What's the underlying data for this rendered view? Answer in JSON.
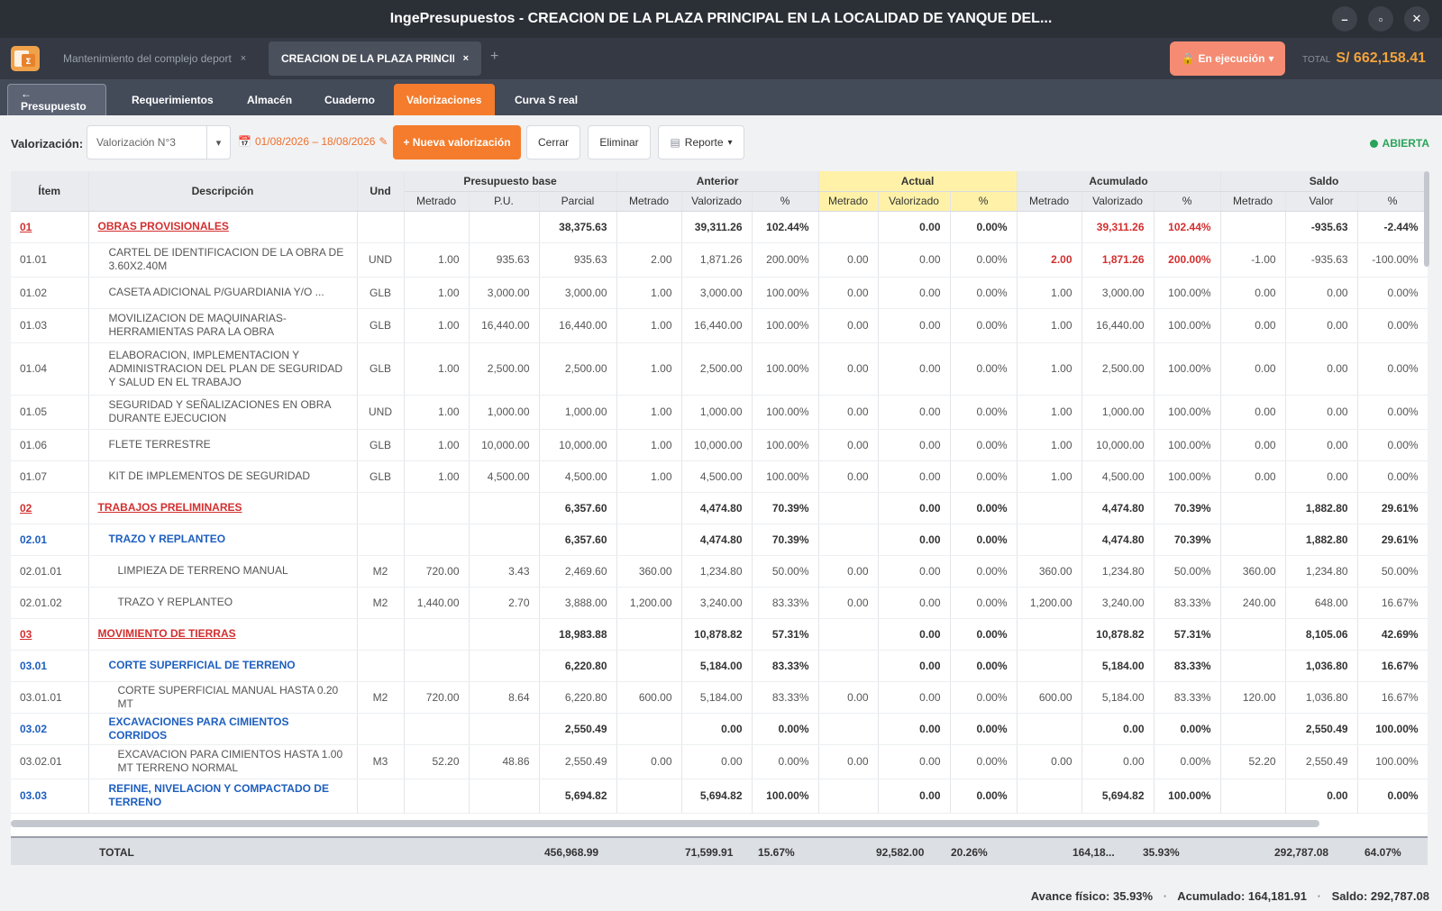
{
  "window": {
    "title": "IngePresupuestos  -  CREACION DE LA PLAZA PRINCIPAL EN LA LOCALIDAD DE YANQUE DEL...",
    "controls": [
      "–",
      "▫",
      "✕"
    ]
  },
  "tabs": {
    "logo_icon": "spreadsheet-logo-icon",
    "items": [
      {
        "label": "Mantenimiento del complejo deport"
      },
      {
        "label": "CREACION DE LA PLAZA PRINCIPA"
      }
    ],
    "close": "×",
    "add": "+"
  },
  "header": {
    "status_button": "En ejecución",
    "status_caret": "▾",
    "total_label": "TOTAL",
    "total_value": "S/ 662,158.41"
  },
  "modules": {
    "back": "← Presupuesto",
    "items": [
      "Requerimientos",
      "Almacén",
      "Cuaderno",
      "Valorizaciones",
      "Curva S real"
    ],
    "active": "Valorizaciones"
  },
  "toolbar": {
    "label": "Valorización:",
    "select_value": "Valorización N°3",
    "date_range": "01/08/2026 – 18/08/2026",
    "new_button": "+ Nueva valorización",
    "close_button": "Cerrar",
    "delete_button": "Eliminar",
    "report_button": "Reporte",
    "status": "ABIERTA",
    "colors": {
      "accent": "#f47c2c",
      "open": "#2aa35a",
      "exec": "#f58b72"
    }
  },
  "table": {
    "col_item": "Ítem",
    "col_desc": "Descripción",
    "col_und": "Und",
    "groups": [
      "Presupuesto base",
      "Anterior",
      "Actual",
      "Acumulado",
      "Saldo"
    ],
    "sub_base": [
      "Metrado",
      "P.U.",
      "Parcial"
    ],
    "sub_anterior": [
      "Metrado",
      "Valorizado",
      "%"
    ],
    "sub_actual": [
      "Metrado",
      "Valorizado",
      "%"
    ],
    "sub_acumulado": [
      "Metrado",
      "Valorizado",
      "%"
    ],
    "sub_saldo": [
      "Metrado",
      "Valor",
      "%"
    ],
    "rows": [
      {
        "kind": "lvl1",
        "cells": [
          "01",
          "OBRAS PROVISIONALES",
          "",
          "",
          "",
          "38,375.63",
          "",
          "39,311.26",
          "102.44%",
          "",
          "0.00",
          "0.00%",
          "",
          "39,311.26",
          "102.44%",
          "",
          "-935.63",
          "-2.44%"
        ],
        "red": [
          13,
          14
        ]
      },
      {
        "kind": "leaf",
        "h": "tall",
        "cells": [
          "01.01",
          "CARTEL DE IDENTIFICACION DE LA OBRA DE 3.60X2.40M",
          "UND",
          "1.00",
          "935.63",
          "935.63",
          "2.00",
          "1,871.26",
          "200.00%",
          "0.00",
          "0.00",
          "0.00%",
          "2.00",
          "1,871.26",
          "200.00%",
          "-1.00",
          "-935.63",
          "-100.00%"
        ],
        "red": [
          12,
          13,
          14
        ]
      },
      {
        "kind": "leaf",
        "cells": [
          "01.02",
          "CASETA ADICIONAL P/GUARDIANIA Y/O ...",
          "GLB",
          "1.00",
          "3,000.00",
          "3,000.00",
          "1.00",
          "3,000.00",
          "100.00%",
          "0.00",
          "0.00",
          "0.00%",
          "1.00",
          "3,000.00",
          "100.00%",
          "0.00",
          "0.00",
          "0.00%"
        ]
      },
      {
        "kind": "leaf",
        "h": "tall",
        "cells": [
          "01.03",
          "MOVILIZACION DE MAQUINARIAS-HERRAMIENTAS PARA LA OBRA",
          "GLB",
          "1.00",
          "16,440.00",
          "16,440.00",
          "1.00",
          "16,440.00",
          "100.00%",
          "0.00",
          "0.00",
          "0.00%",
          "1.00",
          "16,440.00",
          "100.00%",
          "0.00",
          "0.00",
          "0.00%"
        ]
      },
      {
        "kind": "leaf",
        "h": "vtall",
        "cells": [
          "01.04",
          "ELABORACION, IMPLEMENTACION Y ADMINISTRACION DEL PLAN DE SEGURIDAD Y SALUD EN EL TRABAJO",
          "GLB",
          "1.00",
          "2,500.00",
          "2,500.00",
          "1.00",
          "2,500.00",
          "100.00%",
          "0.00",
          "0.00",
          "0.00%",
          "1.00",
          "2,500.00",
          "100.00%",
          "0.00",
          "0.00",
          "0.00%"
        ]
      },
      {
        "kind": "leaf",
        "h": "tall",
        "cells": [
          "01.05",
          "SEGURIDAD Y SEÑALIZACIONES EN OBRA DURANTE EJECUCION",
          "UND",
          "1.00",
          "1,000.00",
          "1,000.00",
          "1.00",
          "1,000.00",
          "100.00%",
          "0.00",
          "0.00",
          "0.00%",
          "1.00",
          "1,000.00",
          "100.00%",
          "0.00",
          "0.00",
          "0.00%"
        ]
      },
      {
        "kind": "leaf",
        "cells": [
          "01.06",
          "FLETE TERRESTRE",
          "GLB",
          "1.00",
          "10,000.00",
          "10,000.00",
          "1.00",
          "10,000.00",
          "100.00%",
          "0.00",
          "0.00",
          "0.00%",
          "1.00",
          "10,000.00",
          "100.00%",
          "0.00",
          "0.00",
          "0.00%"
        ]
      },
      {
        "kind": "leaf",
        "cells": [
          "01.07",
          "KIT DE IMPLEMENTOS DE SEGURIDAD",
          "GLB",
          "1.00",
          "4,500.00",
          "4,500.00",
          "1.00",
          "4,500.00",
          "100.00%",
          "0.00",
          "0.00",
          "0.00%",
          "1.00",
          "4,500.00",
          "100.00%",
          "0.00",
          "0.00",
          "0.00%"
        ]
      },
      {
        "kind": "lvl1",
        "cells": [
          "02",
          "TRABAJOS  PRELIMINARES",
          "",
          "",
          "",
          "6,357.60",
          "",
          "4,474.80",
          "70.39%",
          "",
          "0.00",
          "0.00%",
          "",
          "4,474.80",
          "70.39%",
          "",
          "1,882.80",
          "29.61%"
        ]
      },
      {
        "kind": "lvl2",
        "cells": [
          "02.01",
          "TRAZO Y REPLANTEO",
          "",
          "",
          "",
          "6,357.60",
          "",
          "4,474.80",
          "70.39%",
          "",
          "0.00",
          "0.00%",
          "",
          "4,474.80",
          "70.39%",
          "",
          "1,882.80",
          "29.61%"
        ]
      },
      {
        "kind": "leaf3",
        "cells": [
          "02.01.01",
          "LIMPIEZA DE TERRENO MANUAL",
          "M2",
          "720.00",
          "3.43",
          "2,469.60",
          "360.00",
          "1,234.80",
          "50.00%",
          "0.00",
          "0.00",
          "0.00%",
          "360.00",
          "1,234.80",
          "50.00%",
          "360.00",
          "1,234.80",
          "50.00%"
        ]
      },
      {
        "kind": "leaf3",
        "cells": [
          "02.01.02",
          "TRAZO Y REPLANTEO",
          "M2",
          "1,440.00",
          "2.70",
          "3,888.00",
          "1,200.00",
          "3,240.00",
          "83.33%",
          "0.00",
          "0.00",
          "0.00%",
          "1,200.00",
          "3,240.00",
          "83.33%",
          "240.00",
          "648.00",
          "16.67%"
        ]
      },
      {
        "kind": "lvl1",
        "cells": [
          "03",
          "MOVIMIENTO DE TIERRAS",
          "",
          "",
          "",
          "18,983.88",
          "",
          "10,878.82",
          "57.31%",
          "",
          "0.00",
          "0.00%",
          "",
          "10,878.82",
          "57.31%",
          "",
          "8,105.06",
          "42.69%"
        ]
      },
      {
        "kind": "lvl2",
        "cells": [
          "03.01",
          "CORTE SUPERFICIAL DE TERRENO",
          "",
          "",
          "",
          "6,220.80",
          "",
          "5,184.00",
          "83.33%",
          "",
          "0.00",
          "0.00%",
          "",
          "5,184.00",
          "83.33%",
          "",
          "1,036.80",
          "16.67%"
        ]
      },
      {
        "kind": "leaf3",
        "cells": [
          "03.01.01",
          "CORTE SUPERFICIAL MANUAL HASTA 0.20 MT",
          "M2",
          "720.00",
          "8.64",
          "6,220.80",
          "600.00",
          "5,184.00",
          "83.33%",
          "0.00",
          "0.00",
          "0.00%",
          "600.00",
          "5,184.00",
          "83.33%",
          "120.00",
          "1,036.80",
          "16.67%"
        ]
      },
      {
        "kind": "lvl2",
        "cells": [
          "03.02",
          "EXCAVACIONES PARA CIMIENTOS CORRIDOS",
          "",
          "",
          "",
          "2,550.49",
          "",
          "0.00",
          "0.00%",
          "",
          "0.00",
          "0.00%",
          "",
          "0.00",
          "0.00%",
          "",
          "2,550.49",
          "100.00%"
        ]
      },
      {
        "kind": "leaf3",
        "h": "tall",
        "cells": [
          "03.02.01",
          "EXCAVACION PARA CIMIENTOS HASTA 1.00 MT TERRENO NORMAL",
          "M3",
          "52.20",
          "48.86",
          "2,550.49",
          "0.00",
          "0.00",
          "0.00%",
          "0.00",
          "0.00",
          "0.00%",
          "0.00",
          "0.00",
          "0.00%",
          "52.20",
          "2,550.49",
          "100.00%"
        ]
      },
      {
        "kind": "lvl2",
        "h": "tall",
        "cells": [
          "03.03",
          "REFINE, NIVELACION Y COMPACTADO DE TERRENO",
          "",
          "",
          "",
          "5,694.82",
          "",
          "5,694.82",
          "100.00%",
          "",
          "0.00",
          "0.00%",
          "",
          "5,694.82",
          "100.00%",
          "",
          "0.00",
          "0.00%"
        ]
      }
    ]
  },
  "totals": {
    "label": "TOTAL",
    "base_parcial": "456,968.99",
    "anterior_val": "71,599.91",
    "anterior_pct": "15.67%",
    "actual_val": "92,582.00",
    "actual_pct": "20.26%",
    "acum_val": "164,18...",
    "acum_pct": "35.93%",
    "saldo_val": "292,787.08",
    "saldo_pct": "64.07%"
  },
  "footer": {
    "avance": "Avance físico: 35.93%",
    "acumulado": "Acumulado: 164,181.91",
    "saldo": "Saldo: 292,787.08",
    "sep": "·"
  }
}
